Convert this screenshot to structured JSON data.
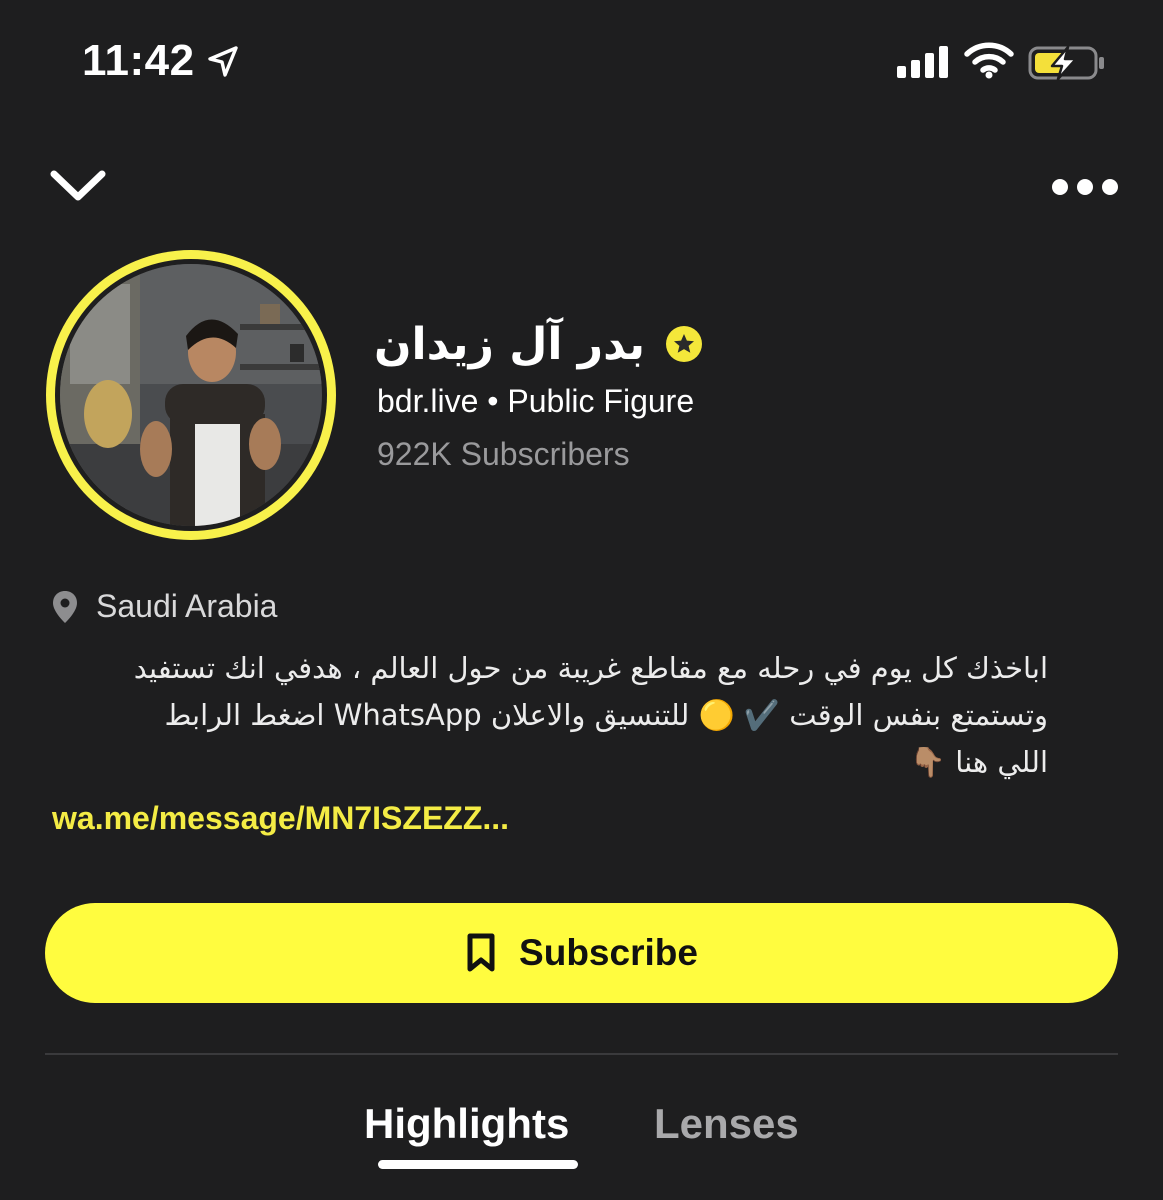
{
  "status_bar": {
    "time": "11:42",
    "location_icon": "location-arrow-icon",
    "signal_icon": "cellular-signal-icon",
    "wifi_icon": "wifi-icon",
    "battery_icon": "battery-charging-icon"
  },
  "nav": {
    "back_icon": "chevron-down-icon",
    "more_icon": "more-horizontal-icon"
  },
  "profile": {
    "display_name": "بدر آل زيدان",
    "verified_icon": "star-badge-icon",
    "handle": "bdr.live",
    "separator": "•",
    "category": "Public Figure",
    "subscribers": "922K Subscribers",
    "location": "Saudi Arabia",
    "bio_lines": [
      "اباخذك كل يوم في رحله مع مقاطع غريبة من حول العالم ، هدفي انك تستفيد",
      "وتستمتع بنفس الوقت ✔️ 🟡 للتنسيق والاعلان WhatsApp اضغط الرابط",
      "اللي هنا 👇🏽"
    ],
    "link": "wa.me/message/MN7ISZEZZ..."
  },
  "actions": {
    "subscribe_label": "Subscribe",
    "subscribe_icon": "bookmark-icon"
  },
  "tabs": {
    "highlights": "Highlights",
    "lenses": "Lenses",
    "active": "Highlights"
  },
  "colors": {
    "background": "#1e1e1f",
    "accent_yellow": "#fffc3f",
    "link_yellow": "#f4ec45",
    "muted_text": "#9a9a9c"
  }
}
